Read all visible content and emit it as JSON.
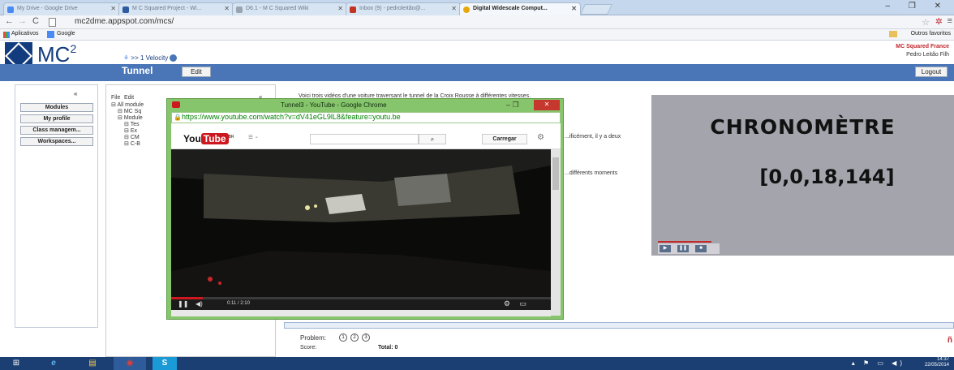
{
  "browser": {
    "tabs": [
      {
        "label": "My Drive - Google Drive",
        "color": "#4a8af4"
      },
      {
        "label": "M C Squared Project - Wi...",
        "color": "#2d5aa0"
      },
      {
        "label": "D6.1 - M C Squared Wiki",
        "color": "#9aa4ae"
      },
      {
        "label": "Inbox (9) - pedroleitão@...",
        "color": "#c23321"
      },
      {
        "label": "Digital Widescale Comput...",
        "color": "#e8a80c"
      }
    ],
    "url": "mc2dme.appspot.com/mcs/",
    "bookmarks": {
      "apps": "Aplicativos",
      "google": "Google",
      "other": "Outros favoritos"
    },
    "window_controls": "– ❐ ✕"
  },
  "app": {
    "logo": "MC",
    "logo_sup": "2",
    "breadcrumb": ">> 1  Velocity",
    "org": "MC Squared France",
    "user": "Pedro Leitão Filh",
    "page_title": "Tunnel",
    "edit_label": "Edit",
    "logout_label": "Logout"
  },
  "left_nav": {
    "collapse": "«",
    "items": [
      "Modules",
      "My profile",
      "Class managem...",
      "Workspaces..."
    ]
  },
  "tree": {
    "menu_file": "File",
    "menu_edit": "Edit",
    "collapse": "«",
    "items": [
      "All module",
      "MC Sq",
      "Module",
      "Tes",
      "Ex",
      "CM",
      "C-B"
    ]
  },
  "content": {
    "intro": "Voici trois vidéos d'une voiture traversant le tunnel de la Croix Rousse à différentes vitesses.",
    "line2": "...ificément, il y a deux",
    "line3": "...différents moments"
  },
  "chronometer": {
    "title": "CHRONOMÈTRE",
    "value": "[0,0,18,144]",
    "buttons": [
      "▶",
      "❚❚",
      "■"
    ]
  },
  "problem": {
    "label": "Problem:",
    "options": [
      "1",
      "2",
      "3"
    ],
    "score_label": "Score:",
    "total_label": "Total: 0"
  },
  "youtube_popup": {
    "window_title": "Tunnel3 - YouTube - Google Chrome",
    "min": "–   ❐",
    "close": "✕",
    "url": "https://www.youtube.com/watch?v=dV41eGL9lL8&feature=youtu.be",
    "logo_you": "You",
    "logo_tube": "Tube",
    "logo_suffix": "BR",
    "menu": "≡ -",
    "search_btn": "⌕",
    "upload_btn": "Carregar",
    "time": "0:11 / 2:10",
    "progress_fraction": 0.084
  },
  "taskbar": {
    "items": [
      "⊞",
      "e",
      "▤",
      "◉",
      "S"
    ],
    "clock_time": "14:37",
    "clock_date": "22/05/2014"
  }
}
